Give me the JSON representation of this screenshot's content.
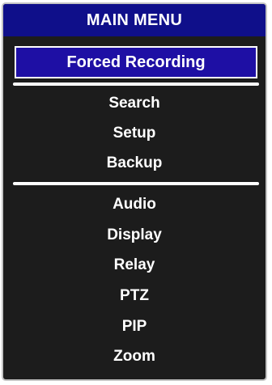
{
  "menu": {
    "title": "MAIN MENU",
    "selected": "Forced Recording",
    "group1": [
      "Search",
      "Setup",
      "Backup"
    ],
    "group2": [
      "Audio",
      "Display",
      "Relay",
      "PTZ",
      "PIP",
      "Zoom"
    ]
  },
  "colors": {
    "title_bar": "#0f0f8a",
    "selected_highlight": "#1e0fa4",
    "menu_background": "#1c1c1c",
    "text": "#ffffff"
  }
}
